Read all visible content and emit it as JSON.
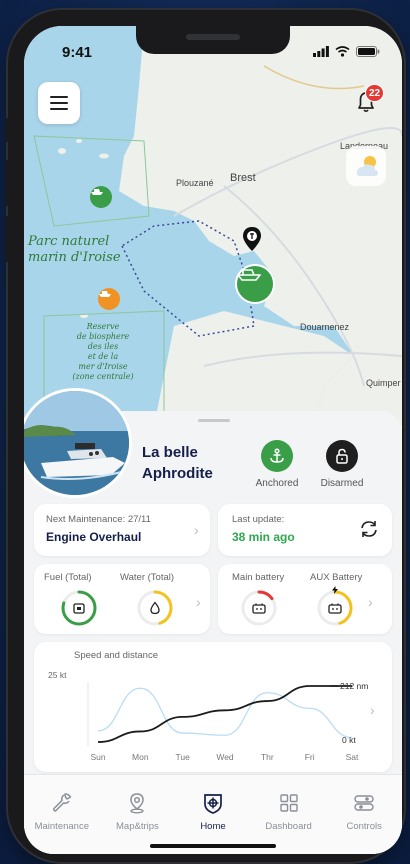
{
  "status_bar": {
    "time": "9:41"
  },
  "notifications": {
    "count": "22"
  },
  "map": {
    "park_label_line1": "Parc naturel",
    "park_label_line2": "marin d'Iroise",
    "reserve_label": [
      "Reserve",
      "de biosphere",
      "des iles",
      "et de la",
      "mer d'Iroise",
      "(zone centrale)"
    ],
    "towns": [
      "Landerneau",
      "Plouzané",
      "Brest",
      "Douarnenez",
      "Quimper"
    ],
    "water_color": "#a9d5ea",
    "land_color": "#eef0ec",
    "vessel_marker_color": "#3a9d47",
    "other_vessel_color": "#f09324"
  },
  "boat": {
    "name_line1": "La belle",
    "name_line2": "Aphrodite",
    "anchor_status": "Anchored",
    "alarm_status": "Disarmed",
    "anchor_color": "#3a9d47",
    "alarm_color": "#1f1f1f"
  },
  "maintenance": {
    "label": "Next Maintenance: 27/11",
    "value": "Engine Overhaul"
  },
  "last_update": {
    "label": "Last update:",
    "value": "38 min ago",
    "value_color": "#2fa84f"
  },
  "tanks": {
    "fuel_label": "Fuel (Total)",
    "water_label": "Water (Total)",
    "fuel_level": 0.8,
    "water_level": 0.45
  },
  "batteries": {
    "main_label": "Main battery",
    "aux_label": "AUX Battery",
    "main_level": 0.15,
    "aux_level": 0.45
  },
  "chart_data": {
    "type": "line",
    "title": "Speed and distance",
    "categories": [
      "Sun",
      "Mon",
      "Tue",
      "Wed",
      "Thr",
      "Fri",
      "Sat"
    ],
    "y_left_top_label": "25 kt",
    "y_right_top_label": "212 nm",
    "y_right_bottom_label": "0 kt",
    "series": [
      {
        "values": [
          0,
          40,
          95,
          120,
          155,
          212,
          212
        ]
      },
      {
        "values": [
          5,
          24,
          4,
          3,
          22,
          15,
          2
        ]
      }
    ]
  },
  "nav": {
    "items": [
      {
        "label": "Maintenance",
        "icon": "wrench-icon"
      },
      {
        "label": "Map&trips",
        "icon": "map-pin-icon"
      },
      {
        "label": "Home",
        "icon": "ship-wheel-icon"
      },
      {
        "label": "Dashboard",
        "icon": "grid-icon"
      },
      {
        "label": "Controls",
        "icon": "toggles-icon"
      }
    ],
    "active_index": 2
  }
}
